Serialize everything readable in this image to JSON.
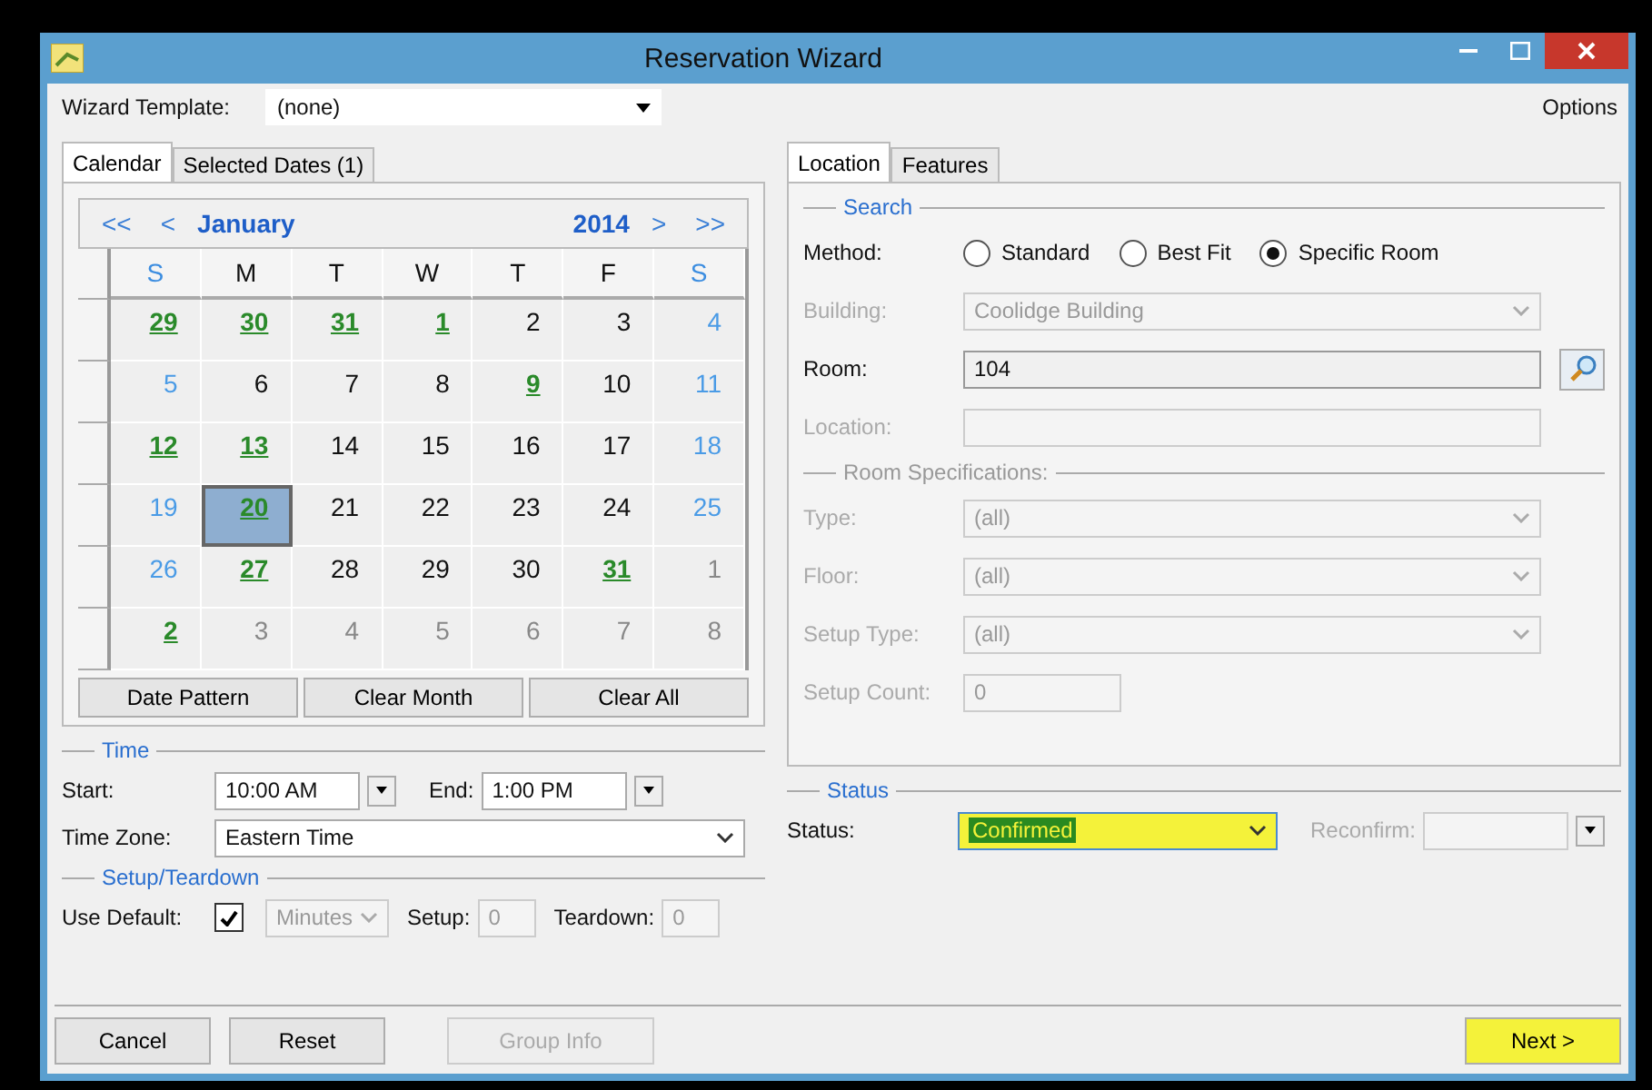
{
  "window": {
    "title": "Reservation Wizard"
  },
  "template": {
    "label": "Wizard Template:",
    "value": "(none)",
    "options": "Options"
  },
  "left_tabs": [
    {
      "label": "Calendar",
      "selected": true
    },
    {
      "label": "Selected Dates (1)",
      "selected": false
    }
  ],
  "calendar": {
    "prev_year": "<<",
    "prev_month": "<",
    "month": "January",
    "year": "2014",
    "next_month": ">",
    "next_year": ">>",
    "weekdays": [
      {
        "label": "S",
        "weekend": true
      },
      {
        "label": "M",
        "weekend": false
      },
      {
        "label": "T",
        "weekend": false
      },
      {
        "label": "W",
        "weekend": false
      },
      {
        "label": "T",
        "weekend": false
      },
      {
        "label": "F",
        "weekend": false
      },
      {
        "label": "S",
        "weekend": true
      }
    ],
    "weeks": [
      [
        {
          "day": "29",
          "kind": "marked",
          "selected": false
        },
        {
          "day": "30",
          "kind": "marked",
          "selected": false
        },
        {
          "day": "31",
          "kind": "marked",
          "selected": false
        },
        {
          "day": "1",
          "kind": "marked",
          "selected": false
        },
        {
          "day": "2",
          "kind": "normal",
          "selected": false
        },
        {
          "day": "3",
          "kind": "normal",
          "selected": false
        },
        {
          "day": "4",
          "kind": "weekend",
          "selected": false
        }
      ],
      [
        {
          "day": "5",
          "kind": "weekend",
          "selected": false
        },
        {
          "day": "6",
          "kind": "normal",
          "selected": false
        },
        {
          "day": "7",
          "kind": "normal",
          "selected": false
        },
        {
          "day": "8",
          "kind": "normal",
          "selected": false
        },
        {
          "day": "9",
          "kind": "marked",
          "selected": false
        },
        {
          "day": "10",
          "kind": "normal",
          "selected": false
        },
        {
          "day": "11",
          "kind": "weekend",
          "selected": false
        }
      ],
      [
        {
          "day": "12",
          "kind": "marked",
          "selected": false
        },
        {
          "day": "13",
          "kind": "marked",
          "selected": false
        },
        {
          "day": "14",
          "kind": "normal",
          "selected": false
        },
        {
          "day": "15",
          "kind": "normal",
          "selected": false
        },
        {
          "day": "16",
          "kind": "normal",
          "selected": false
        },
        {
          "day": "17",
          "kind": "normal",
          "selected": false
        },
        {
          "day": "18",
          "kind": "weekend",
          "selected": false
        }
      ],
      [
        {
          "day": "19",
          "kind": "weekend",
          "selected": false
        },
        {
          "day": "20",
          "kind": "marked",
          "selected": true
        },
        {
          "day": "21",
          "kind": "normal",
          "selected": false
        },
        {
          "day": "22",
          "kind": "normal",
          "selected": false
        },
        {
          "day": "23",
          "kind": "normal",
          "selected": false
        },
        {
          "day": "24",
          "kind": "normal",
          "selected": false
        },
        {
          "day": "25",
          "kind": "weekend",
          "selected": false
        }
      ],
      [
        {
          "day": "26",
          "kind": "weekend",
          "selected": false
        },
        {
          "day": "27",
          "kind": "marked",
          "selected": false
        },
        {
          "day": "28",
          "kind": "normal",
          "selected": false
        },
        {
          "day": "29",
          "kind": "normal",
          "selected": false
        },
        {
          "day": "30",
          "kind": "normal",
          "selected": false
        },
        {
          "day": "31",
          "kind": "marked",
          "selected": false
        },
        {
          "day": "1",
          "kind": "other",
          "selected": false
        }
      ],
      [
        {
          "day": "2",
          "kind": "marked",
          "selected": false
        },
        {
          "day": "3",
          "kind": "other",
          "selected": false
        },
        {
          "day": "4",
          "kind": "other",
          "selected": false
        },
        {
          "day": "5",
          "kind": "other",
          "selected": false
        },
        {
          "day": "6",
          "kind": "other",
          "selected": false
        },
        {
          "day": "7",
          "kind": "other",
          "selected": false
        },
        {
          "day": "8",
          "kind": "other",
          "selected": false
        }
      ]
    ],
    "buttons": [
      "Date Pattern",
      "Clear Month",
      "Clear All"
    ]
  },
  "right_tabs": [
    {
      "label": "Location",
      "selected": true
    },
    {
      "label": "Features",
      "selected": false
    }
  ],
  "search": {
    "legend": "Search",
    "method_label": "Method:",
    "methods": [
      {
        "label": "Standard",
        "selected": false
      },
      {
        "label": "Best Fit",
        "selected": false
      },
      {
        "label": "Specific Room",
        "selected": true
      }
    ],
    "fields": [
      {
        "label": "Building:",
        "value": "Coolidge Building",
        "kind": "dropdown",
        "disabled": true
      },
      {
        "label": "Room:",
        "value": "104",
        "kind": "lookup",
        "disabled": false
      },
      {
        "label": "Location:",
        "kind": "text",
        "disabled": true
      }
    ]
  },
  "room_specs": {
    "legend": "Room Specifications:",
    "fields": [
      {
        "label": "Type:",
        "value": "(all)",
        "kind": "dropdown",
        "disabled": true
      },
      {
        "label": "Floor:",
        "value": "(all)",
        "kind": "dropdown",
        "disabled": true
      },
      {
        "label": "Setup Type:",
        "value": "(all)",
        "kind": "dropdown",
        "disabled": true
      },
      {
        "label": "Setup Count:",
        "value": "0",
        "kind": "short",
        "disabled": true
      }
    ]
  },
  "time": {
    "legend": "Time",
    "start_label": "Start:",
    "start": "10:00 AM",
    "end_label": "End:",
    "end": "1:00 PM",
    "zone_label": "Time Zone:",
    "zone": "Eastern Time"
  },
  "setup": {
    "legend": "Setup/Teardown",
    "use_default_label": "Use Default:",
    "use_default_checked": true,
    "unit": "Minutes",
    "setup_label": "Setup:",
    "setup": "0",
    "teardown_label": "Teardown:",
    "teardown": "0"
  },
  "status": {
    "legend": "Status",
    "label": "Status:",
    "value": "Confirmed",
    "highlighted": true,
    "reconfirm_label": "Reconfirm:",
    "reconfirm_disabled": true
  },
  "footer": [
    {
      "label": "Cancel",
      "disabled": false,
      "highlighted": false
    },
    {
      "label": "Reset",
      "disabled": false,
      "highlighted": false
    },
    {
      "label": "Group Info",
      "disabled": true,
      "highlighted": false
    },
    {
      "label": "Next >",
      "disabled": false,
      "highlighted": true
    }
  ]
}
